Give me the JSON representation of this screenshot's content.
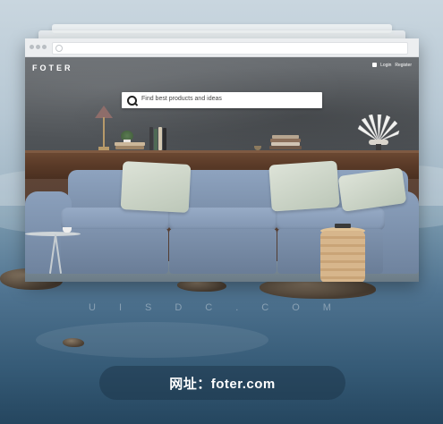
{
  "site": {
    "logo_text": "FOTER",
    "header": {
      "login_label": "Login",
      "register_label": "Register"
    },
    "search": {
      "placeholder": "Find best products and ideas"
    }
  },
  "watermark": "UISDC.COM",
  "caption": "网址：foter.com",
  "colors": {
    "wall": "#5b5f63",
    "sofa": "#8a9fbb",
    "shelf": "#5b3b28",
    "sea": "#4f7390",
    "caption_pill": "#2a4a63"
  }
}
